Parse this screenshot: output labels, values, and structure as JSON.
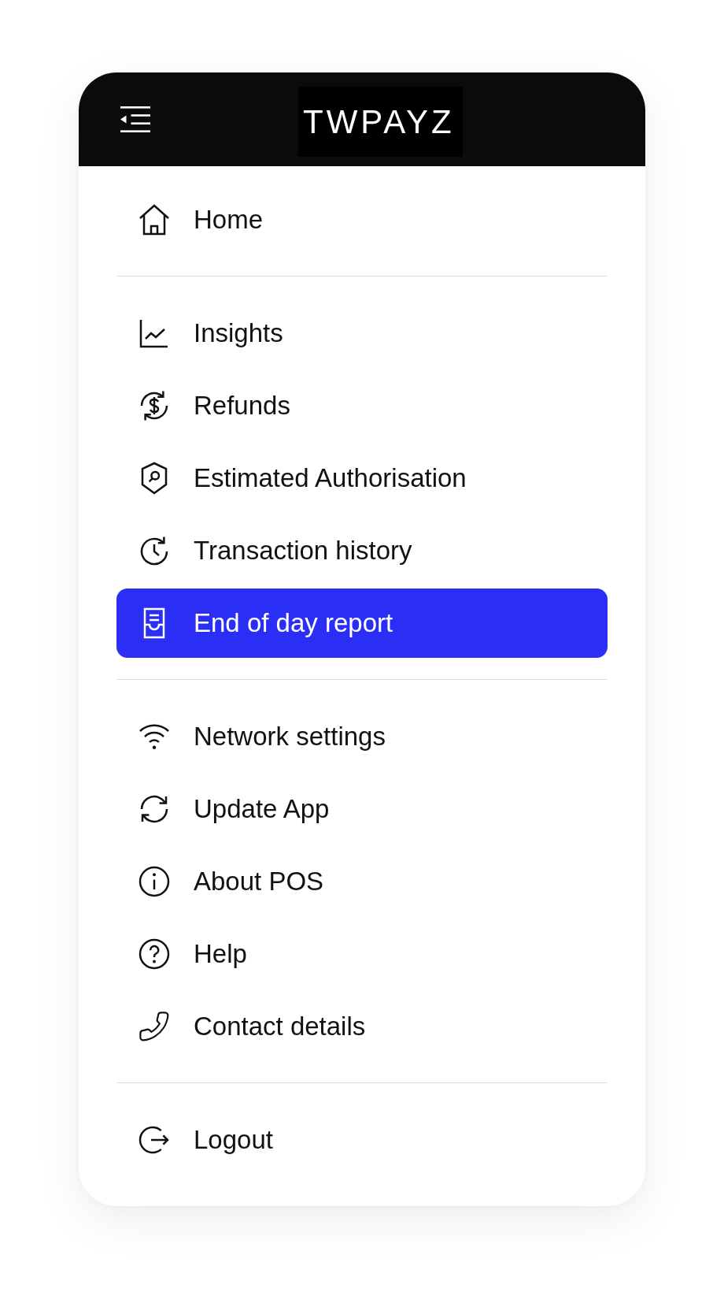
{
  "header": {
    "logo": "TWPAYZ"
  },
  "menu": {
    "sections": [
      {
        "items": [
          {
            "label": "Home",
            "kind": "home",
            "selected": false
          }
        ]
      },
      {
        "items": [
          {
            "label": "Insights",
            "kind": "insights",
            "selected": false
          },
          {
            "label": "Refunds",
            "kind": "refunds",
            "selected": false
          },
          {
            "label": "Estimated Authorisation",
            "kind": "authorisation",
            "selected": false
          },
          {
            "label": "Transaction history",
            "kind": "history",
            "selected": false
          },
          {
            "label": "End of day report",
            "kind": "report",
            "selected": true
          }
        ]
      },
      {
        "items": [
          {
            "label": "Network settings",
            "kind": "network",
            "selected": false
          },
          {
            "label": "Update App",
            "kind": "update",
            "selected": false
          },
          {
            "label": "About POS",
            "kind": "about",
            "selected": false
          },
          {
            "label": "Help",
            "kind": "help",
            "selected": false
          },
          {
            "label": "Contact details",
            "kind": "contact",
            "selected": false
          }
        ]
      },
      {
        "items": [
          {
            "label": "Logout",
            "kind": "logout",
            "selected": false
          }
        ]
      }
    ]
  }
}
